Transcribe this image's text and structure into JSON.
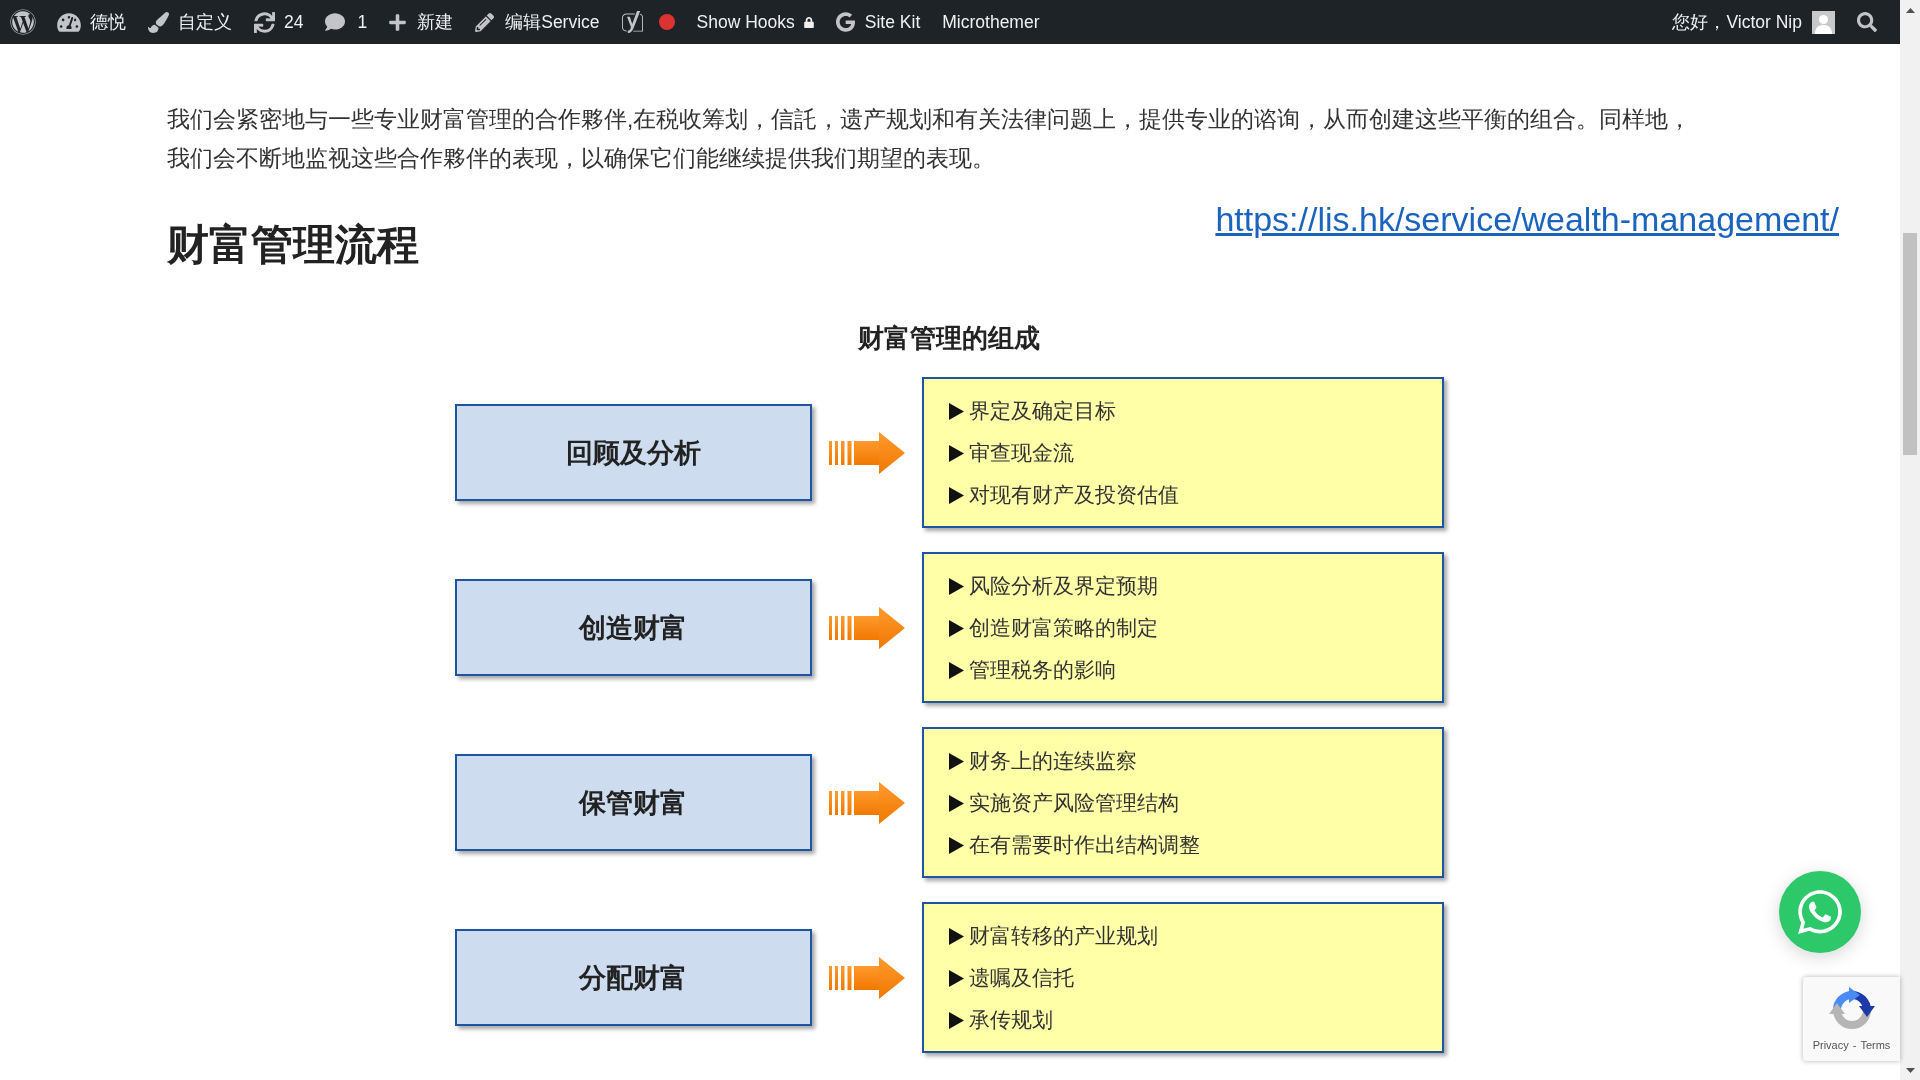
{
  "admin_bar": {
    "site_name": "德悦",
    "customize": "自定义",
    "updates": "24",
    "comments": "1",
    "new": "新建",
    "edit": "编辑Service",
    "show_hooks": "Show Hooks",
    "site_kit": "Site Kit",
    "microthemer": "Microthemer",
    "greeting": "您好，Victor Nip"
  },
  "article": {
    "paragraph": "我们会紧密地与一些专业财富管理的合作夥伴,在税收筹划，信託，遗产规划和有关法律问题上，提供专业的谘询，从而创建这些平衡的组合。同样地，我们会不断地监视这些合作夥伴的表现，以确保它们能继续提供我们期望的表现。",
    "heading": "财富管理流程",
    "link": "https://lis.hk/service/wealth-management/"
  },
  "diagram": {
    "title": "财富管理的组成",
    "stages": [
      {
        "name": "回顾及分析",
        "items": [
          "界定及确定目标",
          "审查现金流",
          "对现有财产及投资估值"
        ]
      },
      {
        "name": "创造财富",
        "items": [
          "风险分析及界定预期",
          "创造财富策略的制定",
          "管理税务的影响"
        ]
      },
      {
        "name": "保管财富",
        "items": [
          "财务上的连续监察",
          "实施资产风险管理结构",
          "在有需要时作出结构调整"
        ]
      },
      {
        "name": "分配财富",
        "items": [
          "财富转移的产业规划",
          "遗嘱及信托",
          "承传规划"
        ]
      }
    ]
  },
  "recaptcha": {
    "privacy": "Privacy",
    "separator": "-",
    "terms": "Terms"
  }
}
